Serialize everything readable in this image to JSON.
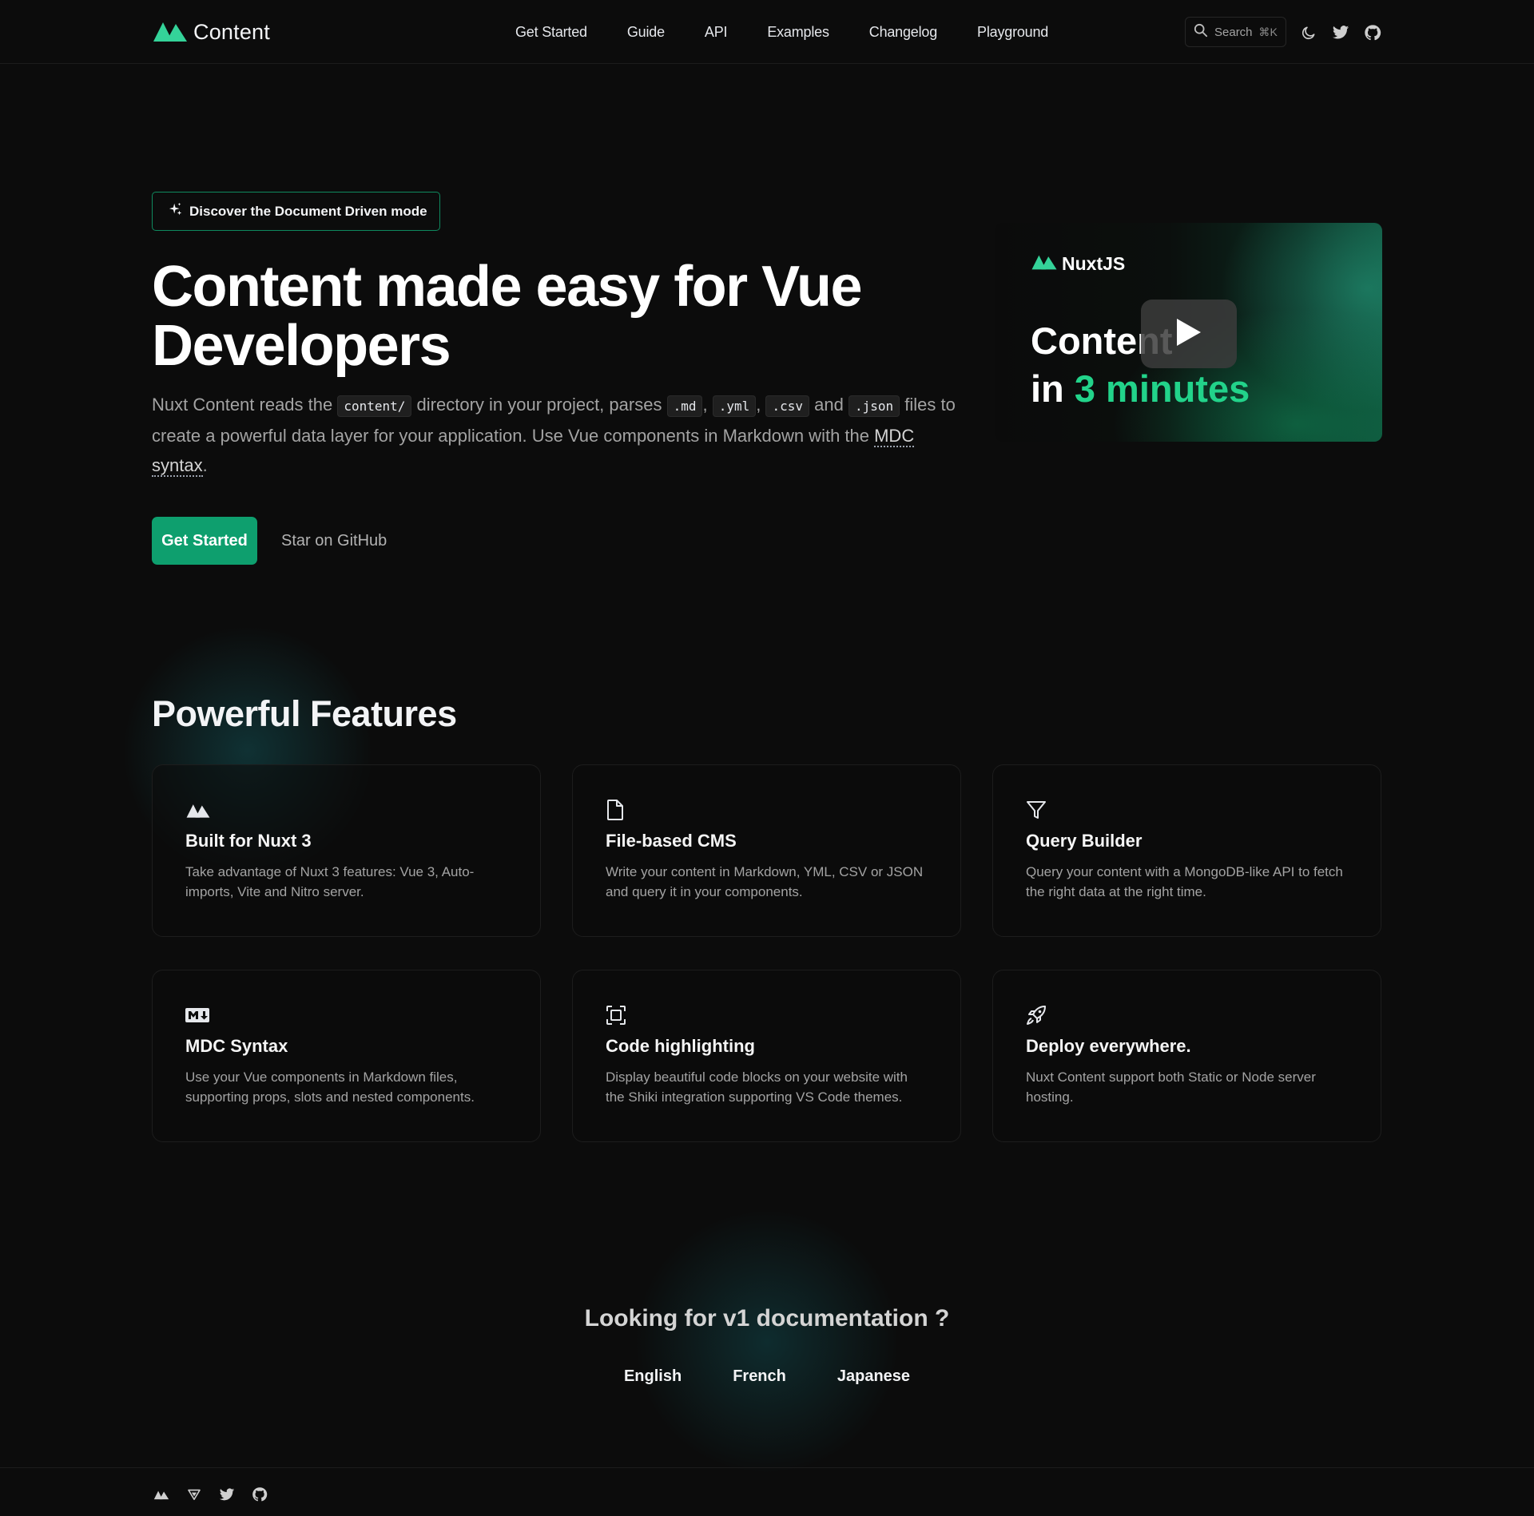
{
  "header": {
    "logo_text": "Content",
    "nav": [
      "Get Started",
      "Guide",
      "API",
      "Examples",
      "Changelog",
      "Playground"
    ],
    "search_label": "Search",
    "search_shortcut": "⌘K",
    "icons": [
      "moon-icon",
      "twitter-icon",
      "github-icon"
    ]
  },
  "hero": {
    "pill_label": "Discover the Document Driven mode",
    "title_line1": "Content made easy for Vue",
    "title_line2": "Developers",
    "desc": {
      "p1": "Nuxt Content reads the ",
      "code_dir": "content/",
      "p2": " directory in your project, parses ",
      "code_md": ".md",
      "sep1": ", ",
      "code_yml": ".yml",
      "sep2": ", ",
      "code_csv": ".csv",
      "p3": " and ",
      "code_json": ".json",
      "p4": " files to create a powerful data layer for your application. Use Vue components in Markdown with the ",
      "link": "MDC syntax",
      "p5": "."
    },
    "primary_button": "Get Started",
    "secondary_button": "Star on GitHub"
  },
  "video": {
    "brand": "NuxtJS",
    "title_line1": "Content",
    "title_line2_a": "in ",
    "title_line2_b": "3 minutes"
  },
  "features": {
    "title": "Powerful Features",
    "items": [
      {
        "icon": "nuxt-icon",
        "title": "Built for Nuxt 3",
        "desc": "Take advantage of Nuxt 3 features: Vue 3, Auto-imports, Vite and Nitro server."
      },
      {
        "icon": "file-icon",
        "title": "File-based CMS",
        "desc": "Write your content in Markdown, YML, CSV or JSON and query it in your components."
      },
      {
        "icon": "filter-icon",
        "title": "Query Builder",
        "desc": "Query your content with a MongoDB-like API to fetch the right data at the right time."
      },
      {
        "icon": "markdown-icon",
        "title": "MDC Syntax",
        "desc": "Use your Vue components in Markdown files, supporting props, slots and nested components."
      },
      {
        "icon": "focus-icon",
        "title": "Code highlighting",
        "desc": "Display beautiful code blocks on your website with the Shiki integration supporting VS Code themes."
      },
      {
        "icon": "rocket-icon",
        "title": "Deploy everywhere.",
        "desc": "Nuxt Content support both Static or Node server hosting."
      }
    ]
  },
  "v1": {
    "title": "Looking for v1 documentation ?",
    "links": [
      "English",
      "French",
      "Japanese"
    ]
  },
  "footer": {
    "icons": [
      "nuxt-icon",
      "vercel-icon",
      "twitter-icon",
      "github-icon"
    ]
  },
  "colors": {
    "background": "#0c0c0c",
    "accent": "#0e9f6e",
    "accent_light": "#22d38a"
  }
}
